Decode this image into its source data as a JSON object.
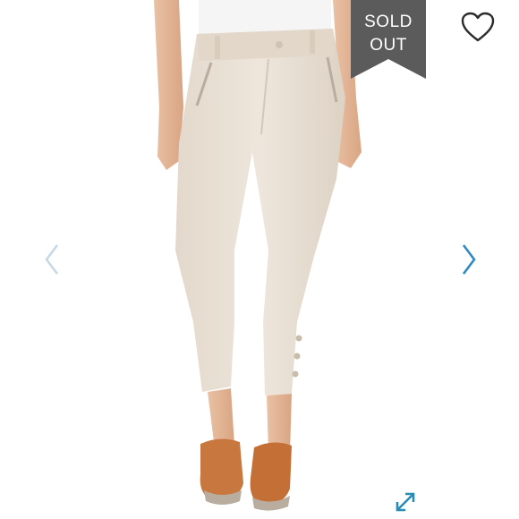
{
  "listing": {
    "status_line1": "SOLD",
    "status_line2": "OUT"
  },
  "icons": {
    "like": "heart-icon",
    "previous": "chevron-left-icon",
    "next": "chevron-right-icon",
    "fullscreen": "expand-icon"
  },
  "colors": {
    "banner": "#5b5b5b",
    "accent_arrow": "#2f8bbf",
    "muted_arrow": "#c7d9e6",
    "expand": "#2a8db5",
    "pants": "#e8dfd4",
    "sandals": "#c8783e"
  }
}
